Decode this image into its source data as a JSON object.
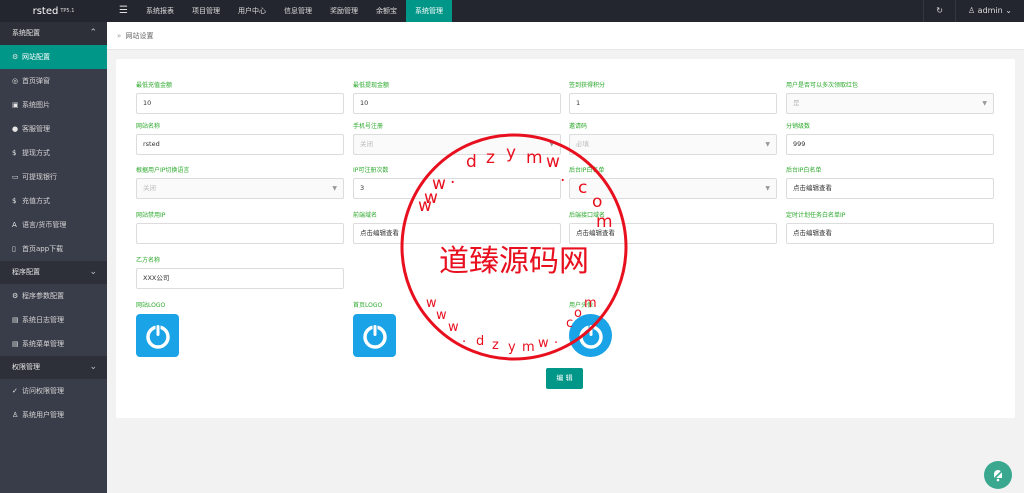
{
  "app": {
    "name": "rsted",
    "version": "TP5.1"
  },
  "topnav": {
    "menu_toggle": "☰",
    "items": [
      "系统报表",
      "项目管理",
      "用户中心",
      "信息管理",
      "奖励管理",
      "余额宝",
      "系统管理"
    ],
    "active_index": 6,
    "refresh_icon": "↻",
    "user": "admin"
  },
  "sidebar": {
    "groups": [
      {
        "label": "系统配置",
        "items": [
          {
            "icon": "⚙",
            "label": "网站配置"
          },
          {
            "icon": "◎",
            "label": "首页弹窗"
          },
          {
            "icon": "▣",
            "label": "系统图片"
          },
          {
            "icon": "●",
            "label": "客服管理"
          },
          {
            "icon": "$",
            "label": "提现方式"
          },
          {
            "icon": "▭",
            "label": "可提现银行"
          },
          {
            "icon": "$",
            "label": "充值方式"
          },
          {
            "icon": "A",
            "label": "语言/货币管理"
          },
          {
            "icon": "▯",
            "label": "首页app下载"
          }
        ]
      },
      {
        "label": "程序配置",
        "items": [
          {
            "icon": "⚙",
            "label": "程序参数配置"
          },
          {
            "icon": "▤",
            "label": "系统日志管理"
          },
          {
            "icon": "▤",
            "label": "系统菜单管理"
          }
        ]
      },
      {
        "label": "权限管理",
        "items": [
          {
            "icon": "✓",
            "label": "访问权限管理"
          },
          {
            "icon": "♙",
            "label": "系统用户管理"
          }
        ]
      }
    ],
    "active_item": "网站配置"
  },
  "breadcrumb": {
    "separator": "»",
    "current": "网站设置"
  },
  "form": {
    "min_recharge": {
      "label": "最低充值金额",
      "value": "10"
    },
    "min_withdraw": {
      "label": "最低提现金额",
      "value": "10"
    },
    "checkin_points": {
      "label": "签到获得积分",
      "value": "1"
    },
    "multi_redpacket": {
      "label": "用户是否可以多次领取红包",
      "value": "是"
    },
    "site_name": {
      "label": "网站名称",
      "value": "rsted"
    },
    "phone_register": {
      "label": "手机号注册",
      "value": "关闭"
    },
    "invite_code": {
      "label": "邀请码",
      "value": "必填"
    },
    "share_levels": {
      "label": "分销级数",
      "value": "999"
    },
    "ip_language": {
      "label": "根据用户IP切换语言",
      "value": "关闭"
    },
    "ip_register_limit": {
      "label": "IP可注册次数",
      "value": "3"
    },
    "admin_ip_whitelist": {
      "label": "后台IP白名单",
      "value": ""
    },
    "admin_ip_list": {
      "label": "后台IP白名单",
      "value": "点击编辑查看"
    },
    "site_ban_ip": {
      "label": "网站禁用IP",
      "value": ""
    },
    "front_domain": {
      "label": "前端域名",
      "value": "点击编辑查看"
    },
    "backend_api": {
      "label": "后端接口域名",
      "value": "点击编辑查看"
    },
    "cron_whitelist": {
      "label": "定时计划任务白名单IP",
      "value": "点击编辑查看"
    },
    "party_b_name": {
      "label": "乙方名称",
      "value": "XXX公司"
    },
    "site_logo": {
      "label": "网站LOGO"
    },
    "home_logo": {
      "label": "首页LOGO"
    },
    "user_avatar": {
      "label": "用户头像"
    },
    "edit_button": "编 辑"
  },
  "watermark": {
    "center_text": "道臻源码网",
    "top_arc": [
      "d",
      "z",
      "y",
      "m",
      "w",
      "."
    ],
    "left_arc": [
      "w",
      "w",
      "w",
      "."
    ],
    "right_arc": [
      "c",
      "o",
      "m"
    ],
    "bottom_arc": [
      "w",
      "w",
      "w",
      ".",
      "d",
      "z",
      "y",
      "m",
      "w",
      ".",
      "c",
      "o",
      "m"
    ]
  },
  "colors": {
    "accent": "#009688",
    "label_green": "#2aa82a",
    "logo_blue": "#1aa3e6",
    "stamp_red": "#e8101e",
    "topbar": "#23262e",
    "sidebar": "#393d49"
  }
}
